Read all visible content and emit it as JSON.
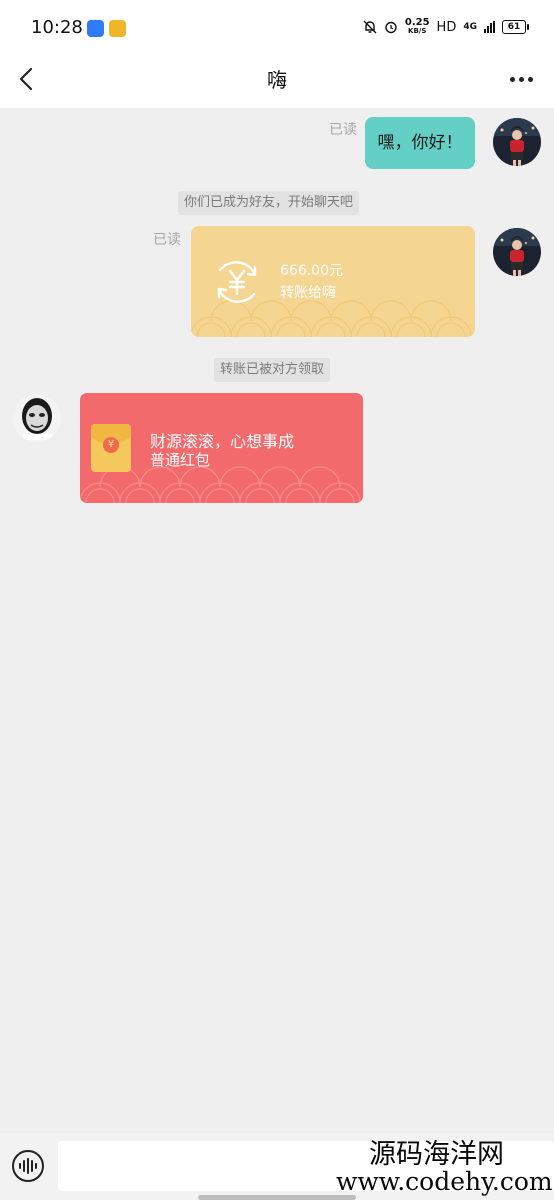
{
  "status_bar": {
    "time": "10:28",
    "net_speed_value": "0.25",
    "net_speed_unit": "KB/S",
    "hd_label": "HD",
    "network_label": "4G",
    "battery_level": "61",
    "app_icon_colors": [
      "#2f7cf6",
      "#f0b62b"
    ]
  },
  "header": {
    "title": "嗨"
  },
  "messages": {
    "text_message": {
      "read_status": "已读",
      "text": "嘿，你好！"
    },
    "friend_tip": "你们已成为好友，开始聊天吧",
    "transfer_message": {
      "read_status": "已读",
      "amount": "666.00元",
      "note": "转账给嗨"
    },
    "transfer_tip": "转账已被对方领取",
    "red_packet": {
      "title": "财源滚滚，心想事成",
      "type": "普通红包",
      "envelope_symbol": "¥"
    }
  },
  "input_bar": {
    "placeholder": ""
  },
  "watermark": {
    "name": "源码海洋网",
    "url": "www.codehy.com"
  },
  "colors": {
    "text_bubble": "#63cfc5",
    "transfer_card": "#f5d592",
    "red_packet_card": "#f36a6c",
    "background": "#efefef"
  },
  "icons": {
    "back": "chevron-left-icon",
    "more": "more-dots-icon",
    "voice": "voice-wave-icon",
    "transfer": "yuan-exchange-icon",
    "envelope": "red-envelope-icon"
  }
}
